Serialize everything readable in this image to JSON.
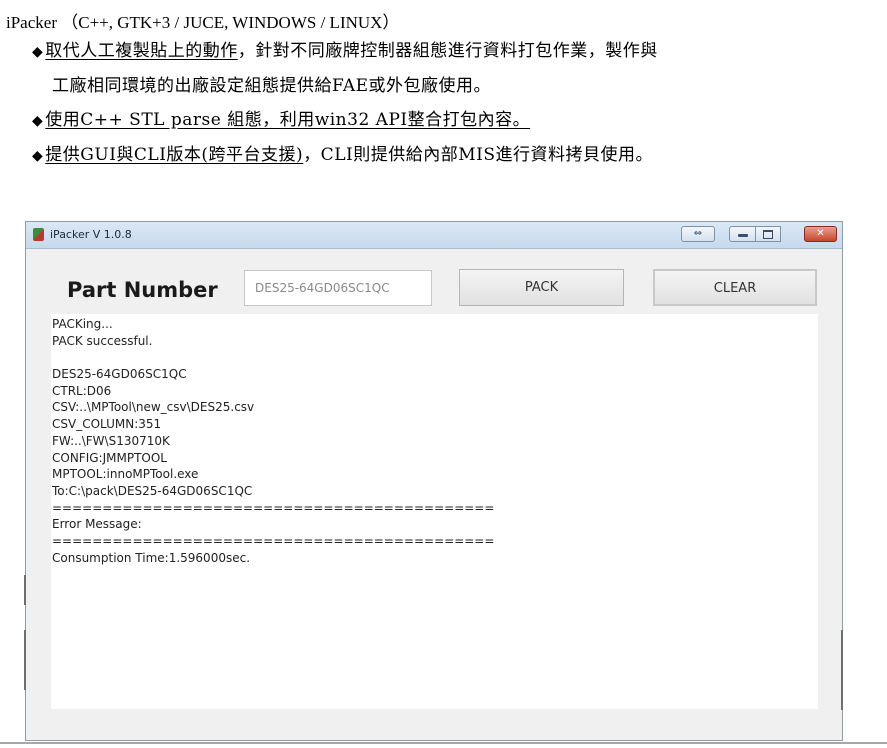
{
  "doc": {
    "title": "iPacker （C++, GTK+3 / JUCE, WINDOWS / LINUX）",
    "bullets": [
      {
        "prefix": "◆",
        "underlined": "取代人工複製貼上的動作",
        "rest": "，針對不同廠牌控制器組態進行資料打包作業，製作與"
      },
      {
        "prefix": "",
        "underlined": "",
        "rest": "工廠相同環境的出廠設定組態提供給FAE或外包廠使用。"
      },
      {
        "prefix": "◆",
        "underlined": "使用C++ STL parse 組態，利用win32 API整合打包內容。",
        "rest": ""
      },
      {
        "prefix": "◆",
        "underlined": "提供GUI與CLI版本(跨平台支援)",
        "rest": "，CLI則提供給內部MIS進行資料拷貝使用。"
      }
    ]
  },
  "window": {
    "title": "iPacker V 1.0.8",
    "controls": {
      "restore": "⇔",
      "close": "✕"
    },
    "part_number_label": "Part Number",
    "part_number_value": "DES25-64GD06SC1QC",
    "pack_button": "PACK",
    "clear_button": "CLEAR",
    "log_lines": [
      "PACKing...",
      "PACK successful.",
      "",
      "DES25-64GD06SC1QC",
      "CTRL:D06",
      "CSV:..\\MPTool\\new_csv\\DES25.csv",
      "CSV_COLUMN:351",
      "FW:..\\FW\\S130710K",
      "CONFIG:JMMPTOOL",
      "MPTOOL:innoMPTool.exe",
      "To:C:\\pack\\DES25-64GD06SC1QC",
      "============================================",
      "Error Message:",
      "============================================",
      "Consumption Time:1.596000sec."
    ]
  }
}
